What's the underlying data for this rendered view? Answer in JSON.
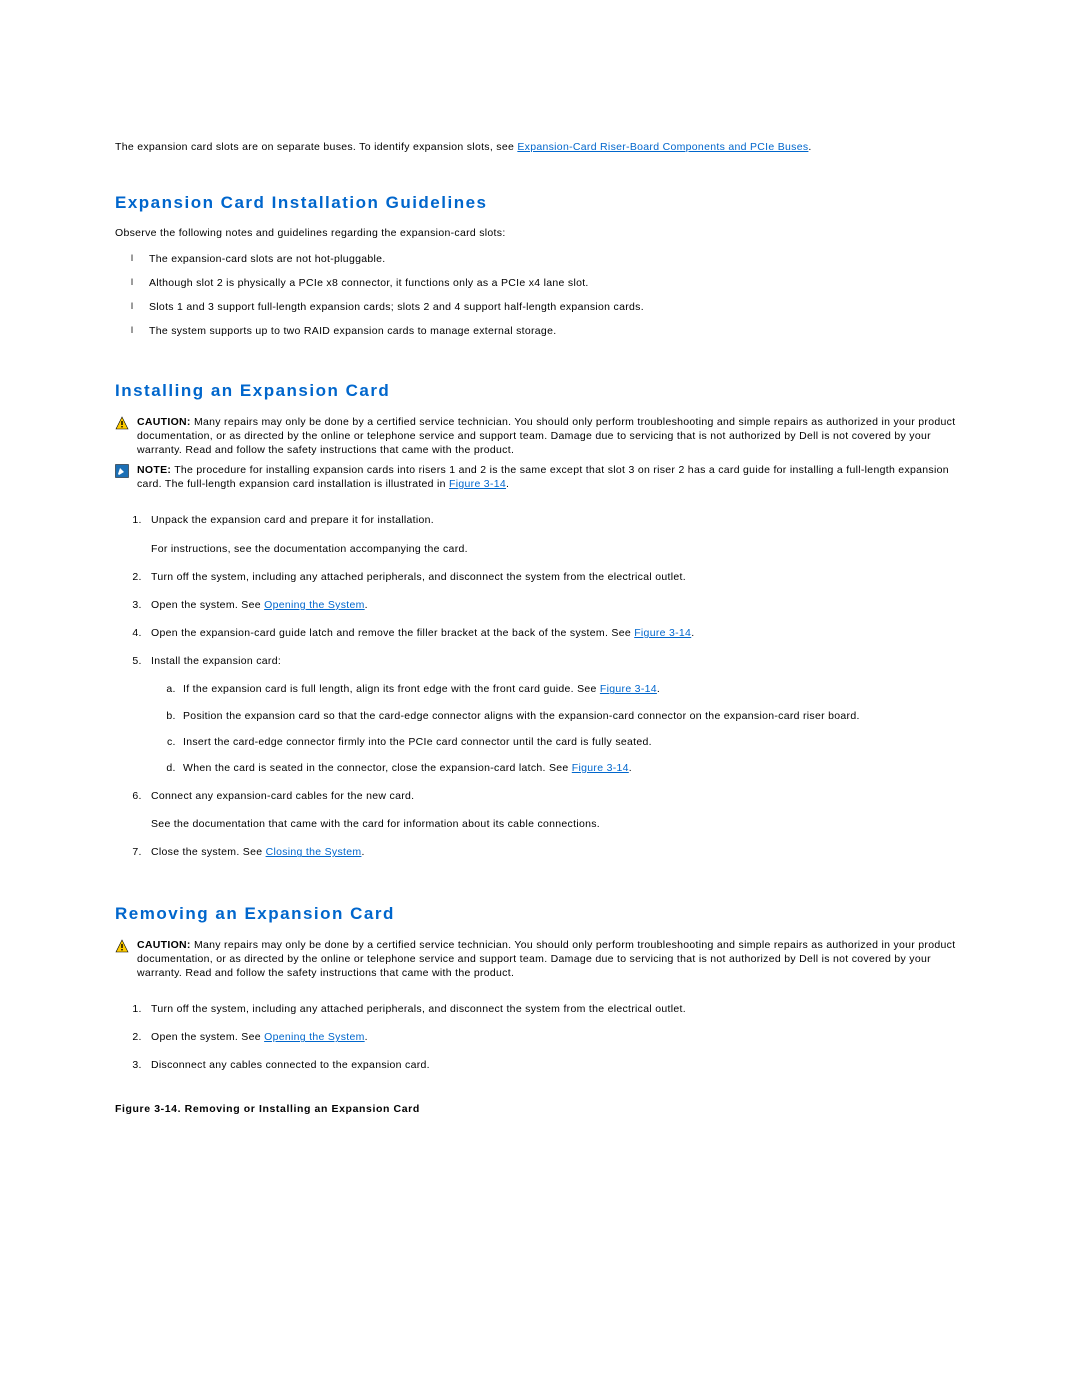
{
  "intro": {
    "text": "The expansion card slots are on separate buses. To identify expansion slots, see ",
    "link": "Expansion-Card Riser-Board Components and PCIe Buses",
    "after": "."
  },
  "section1": {
    "title": "Expansion Card Installation Guidelines",
    "lead": "Observe the following notes and guidelines regarding the expansion-card slots:",
    "bullets": [
      "The expansion-card slots are not hot-pluggable.",
      "Although slot 2 is physically a PCIe x8 connector, it functions only as a PCIe x4 lane slot.",
      "Slots 1 and 3 support full-length expansion cards; slots 2 and 4 support half-length expansion cards.",
      "The system supports up to two RAID expansion cards to manage external storage."
    ]
  },
  "section2": {
    "title": "Installing an Expansion Card",
    "caution_label": "CAUTION:",
    "caution_text": " Many repairs may only be done by a certified service technician. You should only perform troubleshooting and simple repairs as authorized in your product documentation, or as directed by the online or telephone service and support team. Damage due to servicing that is not authorized by Dell is not covered by your warranty. Read and follow the safety instructions that came with the product.",
    "note_label": "NOTE:",
    "note_text_a": " The procedure for installing expansion cards into risers 1 and 2 is the same except that slot 3 on riser 2 has a card guide for installing a full-length expansion card. The full-length expansion card installation is illustrated in ",
    "note_link": "Figure 3-14",
    "note_text_b": ".",
    "steps": {
      "s1a": "Unpack the expansion card and prepare it for installation.",
      "s1b": "For instructions, see the documentation accompanying the card.",
      "s2": "Turn off the system, including any attached peripherals, and disconnect the system from the electrical outlet.",
      "s3a": "Open the system. See ",
      "s3link": "Opening the System",
      "s3b": ".",
      "s4a": "Open the expansion-card guide latch and remove the filler bracket at the back of the system. See ",
      "s4link": "Figure 3-14",
      "s4b": ".",
      "s5": "Install the expansion card:",
      "s5a_a": "If the expansion card is full length, align its front edge with the front card guide. See ",
      "s5a_link": "Figure 3-14",
      "s5a_b": ".",
      "s5b": "Position the expansion card so that the card-edge connector aligns with the expansion-card connector on the expansion-card riser board.",
      "s5c": "Insert the card-edge connector firmly into the PCIe card connector until the card is fully seated.",
      "s5d_a": "When the card is seated in the connector, close the expansion-card latch. See ",
      "s5d_link": "Figure 3-14",
      "s5d_b": ".",
      "s6a": "Connect any expansion-card cables for the new card.",
      "s6b": "See the documentation that came with the card for information about its cable connections.",
      "s7a": "Close the system. See ",
      "s7link": "Closing the System",
      "s7b": "."
    }
  },
  "section3": {
    "title": "Removing an Expansion Card",
    "caution_label": "CAUTION:",
    "caution_text": " Many repairs may only be done by a certified service technician. You should only perform troubleshooting and simple repairs as authorized in your product documentation, or as directed by the online or telephone service and support team. Damage due to servicing that is not authorized by Dell is not covered by your warranty. Read and follow the safety instructions that came with the product.",
    "steps": {
      "s1": "Turn off the system, including any attached peripherals, and disconnect the system from the electrical outlet.",
      "s2a": "Open the system. See ",
      "s2link": "Opening the System",
      "s2b": ".",
      "s3": "Disconnect any cables connected to the expansion card."
    },
    "figure_caption": "Figure 3-14. Removing or Installing an Expansion Card"
  }
}
